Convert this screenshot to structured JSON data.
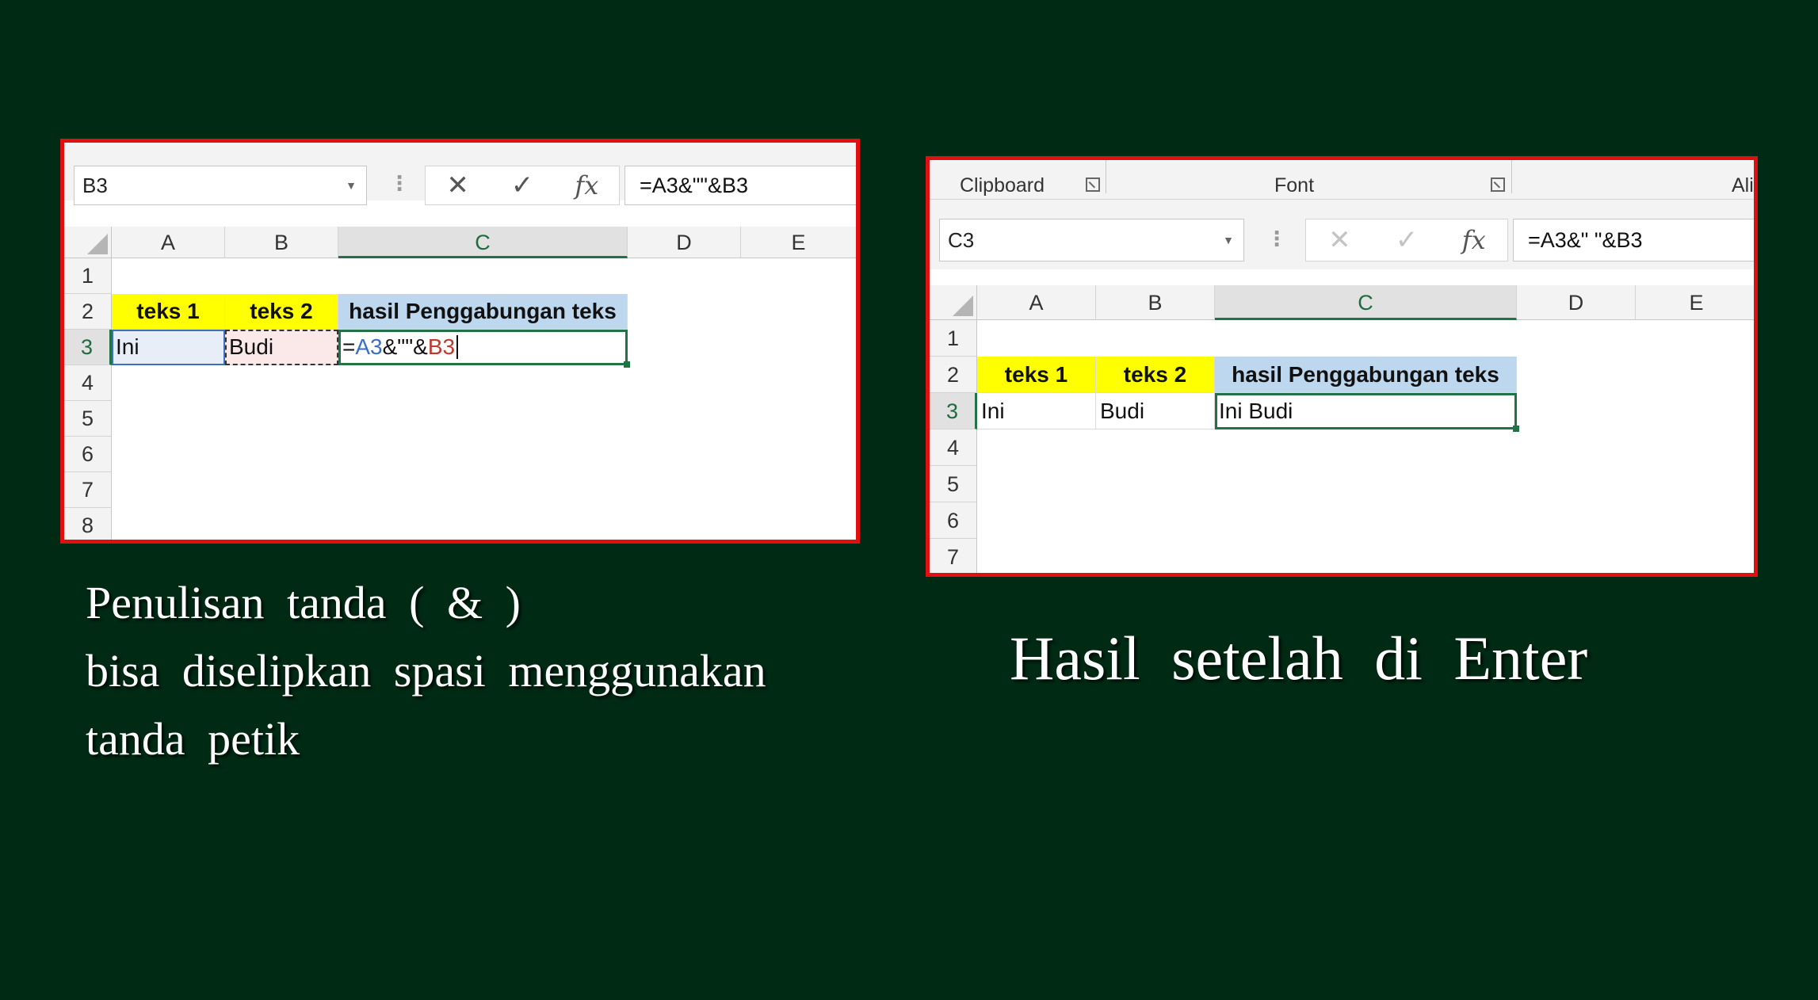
{
  "left_panel": {
    "name_box": "B3",
    "formula": "=A3&\"\"&B3",
    "columns": [
      "A",
      "B",
      "C",
      "D",
      "E"
    ],
    "rows": [
      "1",
      "2",
      "3",
      "4",
      "5",
      "6",
      "7",
      "8"
    ],
    "cells": {
      "a2": "teks 1",
      "b2": "teks 2",
      "c2": "hasil Penggabungan teks",
      "a3": "Ini",
      "b3": "Budi",
      "c3_eq": "=",
      "c3_ref_a": "A3",
      "c3_mid": "&\"\"&",
      "c3_ref_b": "B3"
    }
  },
  "right_panel": {
    "ribbon": {
      "clipboard": "Clipboard",
      "font": "Font",
      "alignment_partial": "Alig"
    },
    "name_box": "C3",
    "formula": "=A3&\" \"&B3",
    "columns": [
      "A",
      "B",
      "C",
      "D",
      "E"
    ],
    "rows": [
      "1",
      "2",
      "3",
      "4",
      "5",
      "6",
      "7"
    ],
    "cells": {
      "a2": "teks 1",
      "b2": "teks 2",
      "c2": "hasil Penggabungan teks",
      "a3": "Ini",
      "b3": "Budi",
      "c3": "Ini Budi"
    }
  },
  "captions": {
    "left_line1": "Penulisan tanda ( & )",
    "left_line2": "bisa diselipkan spasi menggunakan",
    "left_line3": "tanda petik",
    "right": "Hasil setelah di Enter"
  },
  "colors": {
    "background": "#012a14",
    "panel_border": "#e01010",
    "excel_green": "#217346",
    "highlight_yellow": "#ffff00",
    "highlight_blue": "#bdd7ee"
  },
  "icons": {
    "cancel": "x-icon",
    "enter": "check-icon",
    "function": "fx-icon",
    "dropdown": "chevron-down-icon"
  }
}
